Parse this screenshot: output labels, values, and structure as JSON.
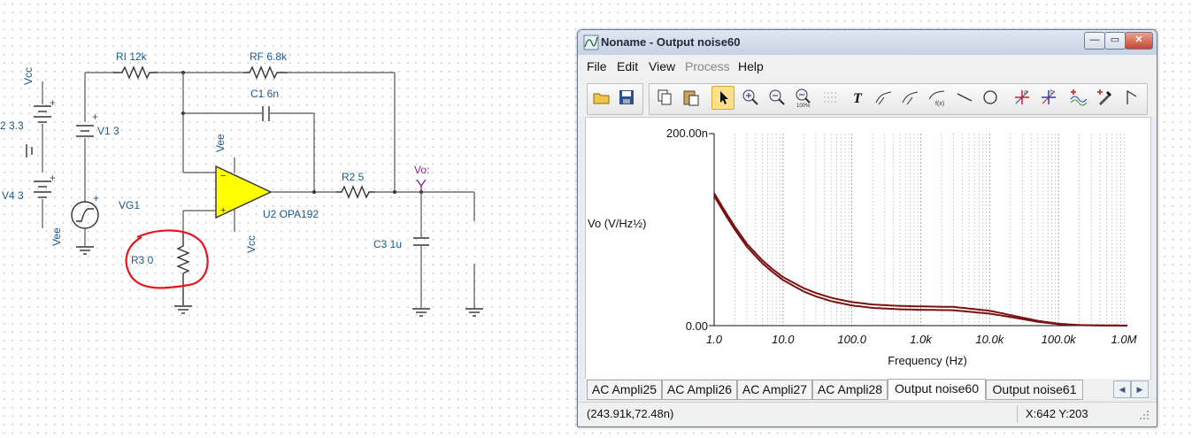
{
  "schematic": {
    "labels": {
      "vcc_left": "Vcc",
      "v2": "2 3.3",
      "v4": "V4 3",
      "vee_left": "Vee",
      "v1": "V1 3",
      "vg1": "VG1",
      "ri": "RI 12k",
      "rf": "RF 6.8k",
      "c1": "C1 6n",
      "vee_op": "Vee",
      "vcc_op": "Vcc",
      "u2": "U2 OPA192",
      "r2": "R2 5",
      "vo": "Vo:",
      "c3": "C3 1u",
      "r3": "R3 0"
    },
    "annotation_color": "#e8161c",
    "opamp_color": "#ffff00"
  },
  "window": {
    "title": "Noname - Output noise60",
    "buttons": {
      "minimize": "—",
      "maximize": "▭",
      "close": "✕"
    },
    "menu": [
      "File",
      "Edit",
      "View",
      "Process",
      "Help"
    ],
    "menu_disabled": [
      "Process"
    ],
    "toolbar_icons": [
      "open-icon",
      "save-icon",
      "copy-icon",
      "paste-icon",
      "pointer-icon",
      "zoom-in-icon",
      "zoom-out-icon",
      "zoom-100-icon",
      "grid-icon",
      "text-icon",
      "probe-icon",
      "probe-2-icon",
      "formula-icon",
      "line-icon",
      "circle-icon",
      "cursor-a-icon",
      "cursor-b-icon",
      "add-curve-icon",
      "pick-color-icon",
      "flag-icon"
    ],
    "tabs": [
      "AC Ampli25",
      "AC Ampli26",
      "AC Ampli27",
      "AC Ampli28",
      "Output noise60",
      "Output noise61"
    ],
    "active_tab": "Output noise60",
    "status": {
      "cursor": "(243.91k,72.48n)",
      "xy": "X:642  Y:203"
    }
  },
  "chart_data": {
    "type": "line",
    "ylabel": "Vo (V/Hz½)",
    "xlabel": "Frequency (Hz)",
    "xscale": "log",
    "xlim": [
      1,
      1000000
    ],
    "ylim": [
      0,
      2e-07
    ],
    "y_ticks": [
      "200.00n",
      "0.00"
    ],
    "x_ticks": [
      "1.0",
      "10.0",
      "100.0",
      "1.0k",
      "10.0k",
      "100.0k",
      "1.0M"
    ],
    "grid": "vertical log grid",
    "series": [
      {
        "color": "#7a1010",
        "x": [
          1,
          1.5,
          2,
          3,
          5,
          7,
          10,
          20,
          30,
          50,
          100,
          200,
          500,
          1000,
          3000,
          10000,
          20000,
          50000,
          100000,
          200000,
          500000,
          1000000
        ],
        "values": [
          1.38e-07,
          1.17e-07,
          1.03e-07,
          8.5e-08,
          6.8e-08,
          5.9e-08,
          5.05e-08,
          3.9e-08,
          3.4e-08,
          2.9e-08,
          2.45e-08,
          2.2e-08,
          2.05e-08,
          2e-08,
          1.95e-08,
          1.55e-08,
          1.1e-08,
          5e-09,
          2e-09,
          6e-10,
          2e-10,
          1e-10
        ]
      },
      {
        "color": "#7a1010",
        "x": [
          1,
          1.5,
          2,
          3,
          5,
          7,
          10,
          20,
          30,
          50,
          100,
          200,
          500,
          1000,
          3000,
          10000,
          20000,
          50000,
          100000,
          200000,
          500000,
          1000000
        ],
        "values": [
          1.35e-07,
          1.14e-07,
          1e-07,
          8.2e-08,
          6.5e-08,
          5.6e-08,
          4.75e-08,
          3.55e-08,
          3.05e-08,
          2.55e-08,
          2.1e-08,
          1.85e-08,
          1.7e-08,
          1.65e-08,
          1.6e-08,
          1.25e-08,
          9e-09,
          4e-09,
          1.5e-09,
          5e-10,
          1e-10,
          0
        ]
      }
    ]
  }
}
